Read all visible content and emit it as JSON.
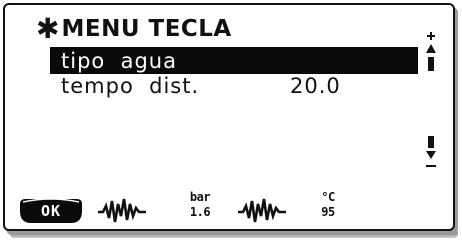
{
  "header": {
    "asterisk": "✱",
    "title": "MENU TECLA"
  },
  "menu": {
    "items": [
      {
        "label": "tipo  agua",
        "value": ""
      },
      {
        "label": "tempo  dist.",
        "value": "20.0"
      }
    ]
  },
  "scrollbar": {
    "up_icon": "scroll-up-icon",
    "down_icon": "scroll-down-icon"
  },
  "softkeys": {
    "ok_label": "OK",
    "pressure_unit": "bar",
    "pressure_value": "1.6",
    "temp_unit": "°C",
    "temp_value": "95",
    "wave_icon": "waveform-icon"
  }
}
